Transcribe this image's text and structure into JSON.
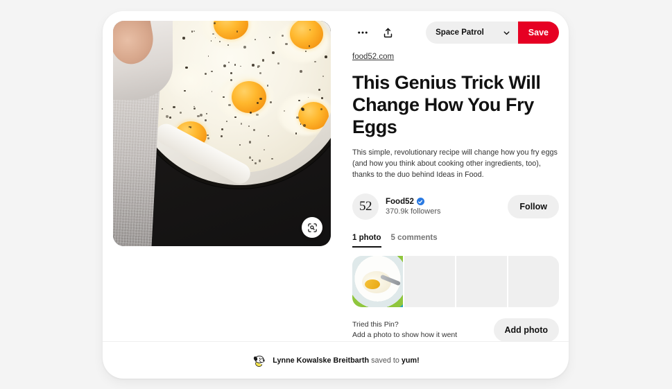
{
  "card": {
    "image": {
      "alt_description": "Fried eggs cooking in a white enameled cast iron skillet on a dark stovetop, sprinkled with black pepper, with a checked gray cloth at left",
      "lens_icon": "visual-search-icon"
    },
    "actions": {
      "more_icon": "ellipsis-icon",
      "share_icon": "share-upload-icon",
      "board_name": "Space Patrol",
      "board_chevron_icon": "chevron-down-icon",
      "save_label": "Save",
      "save_color": "#e60023"
    },
    "source": "food52.com",
    "title": "This Genius Trick Will Change How You Fry Eggs",
    "description": "This simple, revolutionary recipe will change how you fry eggs (and how you think about cooking other ingredients, too), thanks to the duo behind Ideas in Food.",
    "creator": {
      "avatar_text": "52",
      "name": "Food52",
      "verified_icon": "verified-badge-icon",
      "followers": "370.9k followers",
      "follow_label": "Follow"
    },
    "tabs": [
      {
        "label": "1 photo",
        "active": true
      },
      {
        "label": "5 comments",
        "active": false
      }
    ],
    "photos": {
      "tiles": [
        {
          "has_image": true,
          "alt": "plate with scrambled eggs and a fork on a green and teal rimmed plate"
        },
        {
          "has_image": false
        },
        {
          "has_image": false
        },
        {
          "has_image": false
        }
      ],
      "tried_heading": "Tried this Pin?",
      "tried_subtext": "Add a photo to show how it went",
      "add_photo_label": "Add photo"
    },
    "saved_by": {
      "avatar_icon": "snoopy-avatar-icon",
      "user": "Lynne Kowalske Breitbarth",
      "connector": " saved to ",
      "board": "yum!"
    }
  }
}
